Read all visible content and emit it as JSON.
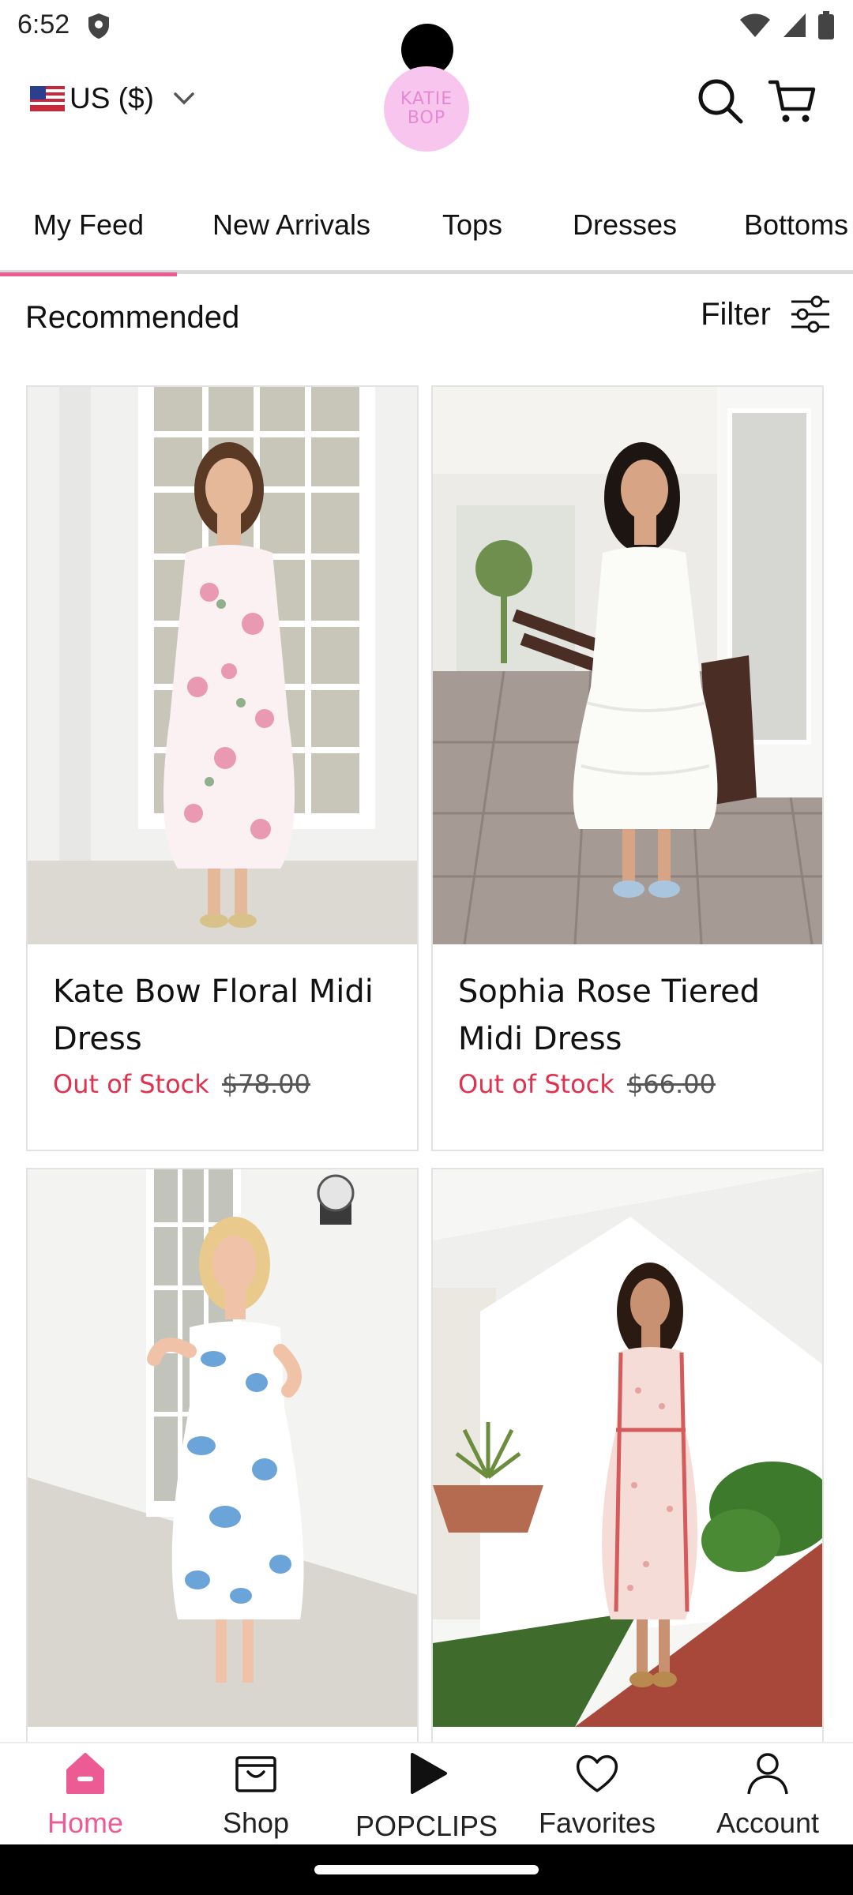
{
  "status": {
    "time": "6:52"
  },
  "header": {
    "currency_label": "US ($)",
    "logo_line1": "KATIE",
    "logo_line2": "BOP"
  },
  "tabs": [
    {
      "label": "My Feed",
      "active": true
    },
    {
      "label": "New Arrivals",
      "active": false
    },
    {
      "label": "Tops",
      "active": false
    },
    {
      "label": "Dresses",
      "active": false
    },
    {
      "label": "Bottoms",
      "active": false
    }
  ],
  "section": {
    "title": "Recommended",
    "filter_label": "Filter"
  },
  "products": [
    {
      "title": "Kate Bow Floral Midi Dress",
      "stock": "Out of Stock",
      "price": "$78.00"
    },
    {
      "title": "Sophia Rose Tiered Midi Dress",
      "stock": "Out of Stock",
      "price": "$66.00"
    },
    {
      "title": "",
      "stock": "",
      "price": ""
    },
    {
      "title": "",
      "stock": "",
      "price": ""
    }
  ],
  "bottom_nav": [
    {
      "label": "Home",
      "icon": "home-icon",
      "active": true
    },
    {
      "label": "Shop",
      "icon": "shop-icon",
      "active": false
    },
    {
      "label": "POPCLIPS",
      "icon": "play-icon",
      "active": false
    },
    {
      "label": "Favorites",
      "icon": "heart-icon",
      "active": false
    },
    {
      "label": "Account",
      "icon": "account-icon",
      "active": false
    }
  ],
  "colors": {
    "accent": "#ec5b93",
    "out_of_stock": "#e0324e",
    "logo_bg": "#f8c5ee"
  }
}
